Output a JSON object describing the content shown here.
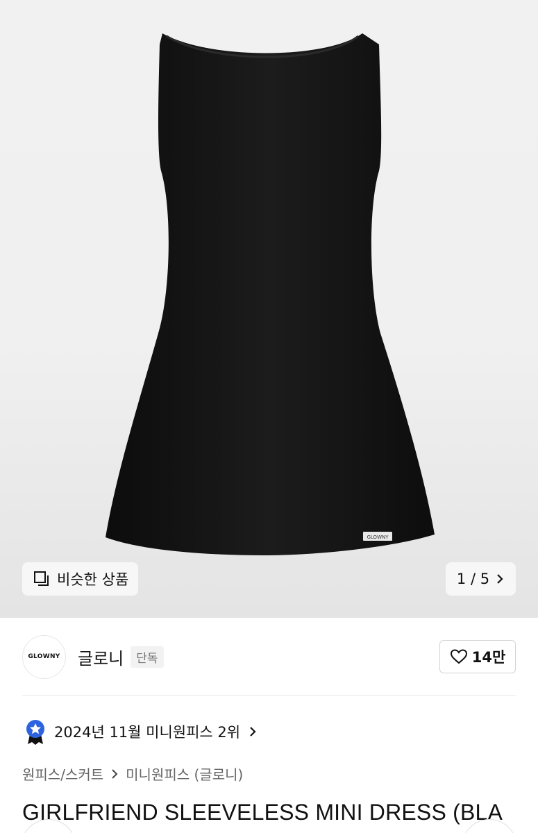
{
  "hero": {
    "image_alt": "Black sleeveless mini dress",
    "tag_label": "GLOWNY",
    "similar_button": {
      "icon": "similar-items-icon",
      "label": "비슷한 상품"
    },
    "pager": {
      "current": "1",
      "total": "5",
      "text": "1 / 5"
    }
  },
  "brand": {
    "logo_text": "GLOWNY",
    "name": "글로니",
    "badge": "단독",
    "likes": {
      "icon": "heart-icon",
      "count": "14만"
    }
  },
  "ranking": {
    "icon": "medal-icon",
    "text": "2024년 11월 미니원피스 2위"
  },
  "breadcrumb": {
    "items": [
      "원피스/스커트",
      "미니원피스 (글로니)"
    ]
  },
  "product": {
    "title": "GIRLFRIEND SLEEVELESS MINI DRESS (BLA"
  },
  "colors": {
    "accent_blue": "#2e63e0",
    "badge_bg": "#f2f2f2",
    "dress": "#111111"
  }
}
